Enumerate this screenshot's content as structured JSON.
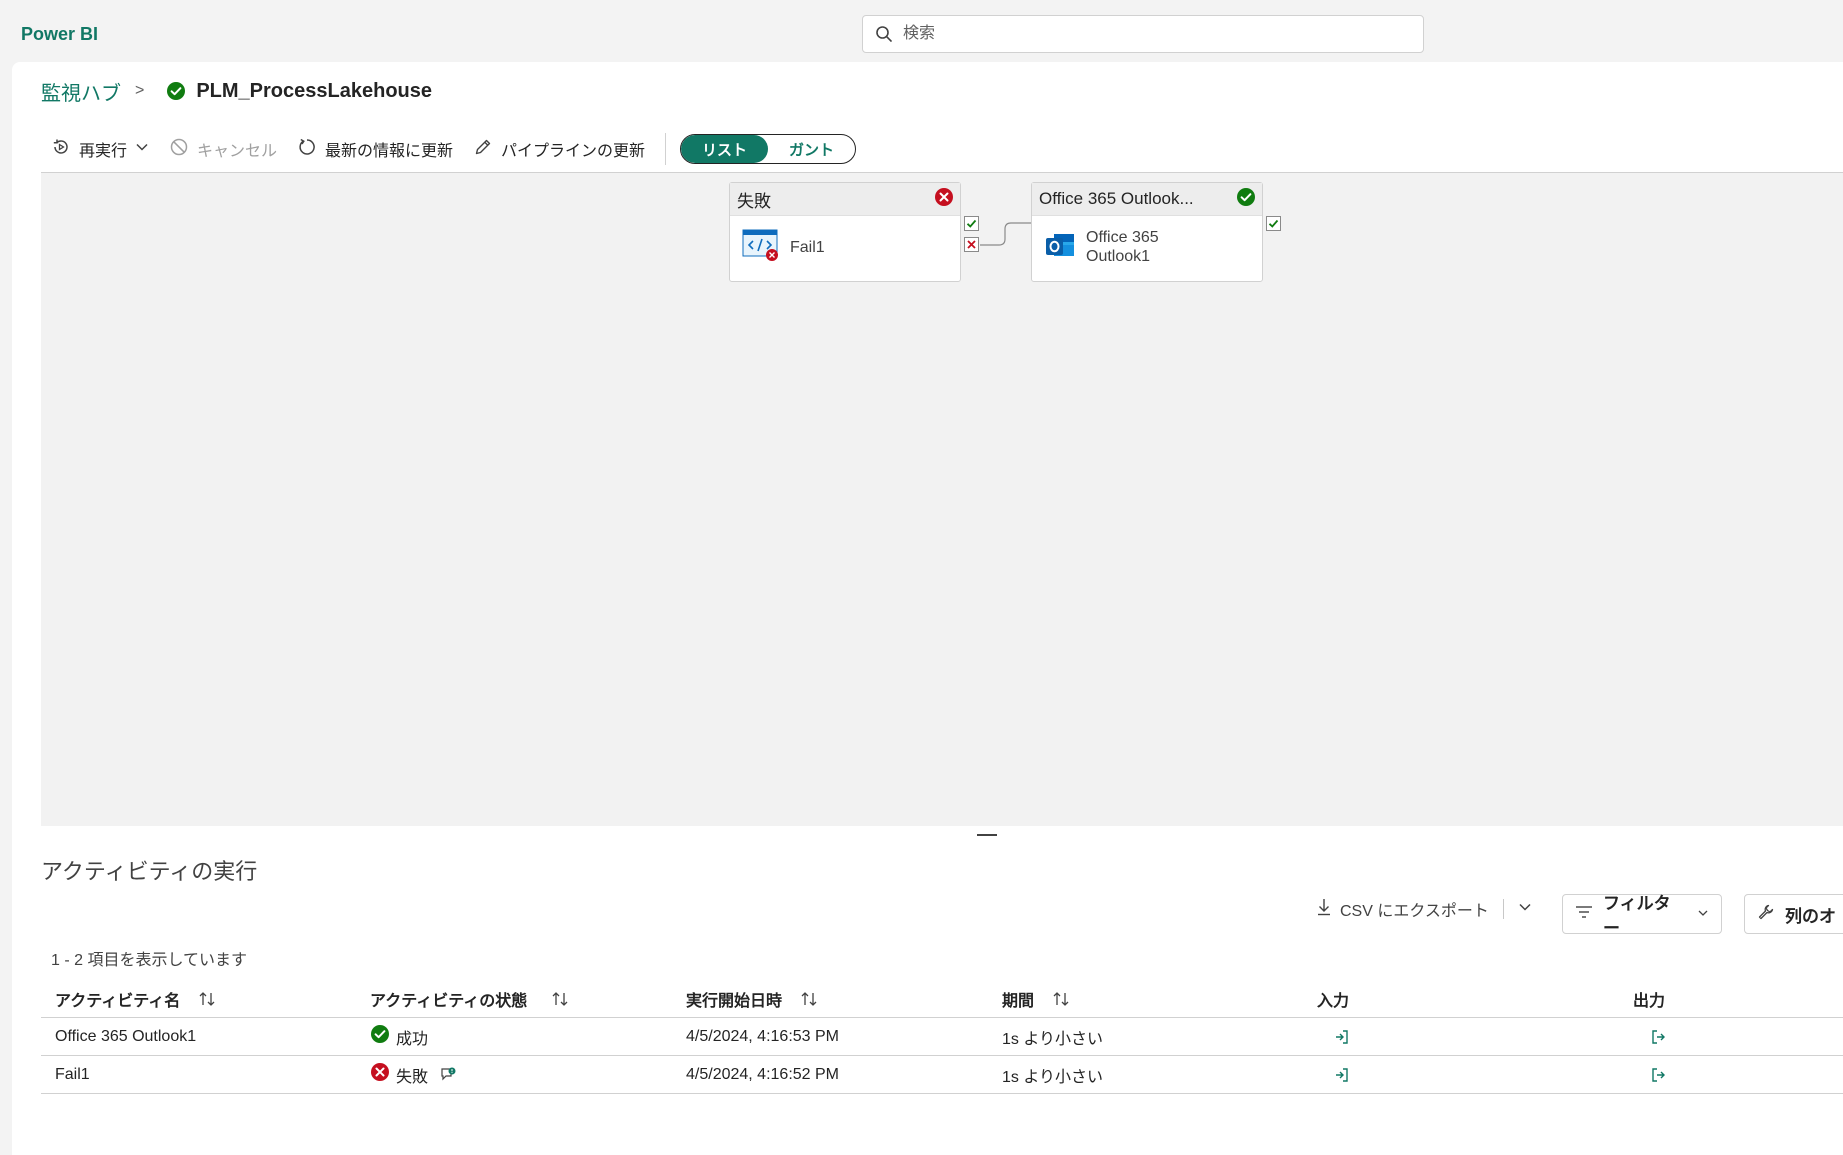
{
  "app": {
    "name": "Power BI"
  },
  "search": {
    "placeholder": "検索"
  },
  "breadcrumb": {
    "parent": "監視ハブ",
    "separator": ">",
    "current": "PLM_ProcessLakehouse"
  },
  "toolbar": {
    "rerun": "再実行",
    "cancel": "キャンセル",
    "refresh": "最新の情報に更新",
    "update_pipeline": "パイプラインの更新",
    "view_list": "リスト",
    "view_gantt": "ガント"
  },
  "nodes": [
    {
      "header": "失敗",
      "status": "failed",
      "label": "Fail1",
      "icon": "script-fail-icon"
    },
    {
      "header": "Office 365 Outlook...",
      "status": "succeeded",
      "label_line1": "Office 365",
      "label_line2": "Outlook1",
      "icon": "outlook-icon"
    }
  ],
  "activity_runs": {
    "title": "アクティビティの実行",
    "export_label": "CSV にエクスポート",
    "filter_label": "フィルター",
    "column_options_label": "列のオ",
    "count_text": "1 - 2 項目を表示しています",
    "columns": [
      "アクティビティ名",
      "アクティビティの状態",
      "実行開始日時",
      "期間",
      "入力",
      "出力"
    ],
    "rows": [
      {
        "name": "Office 365 Outlook1",
        "status": "成功",
        "status_type": "succeeded",
        "start": "4/5/2024, 4:16:53 PM",
        "duration": "1s より小さい"
      },
      {
        "name": "Fail1",
        "status": "失敗",
        "status_type": "failed",
        "start": "4/5/2024, 4:16:52 PM",
        "duration": "1s より小さい"
      }
    ]
  },
  "colors": {
    "brand": "#117865",
    "success": "#107c10",
    "error": "#c50f1f"
  }
}
